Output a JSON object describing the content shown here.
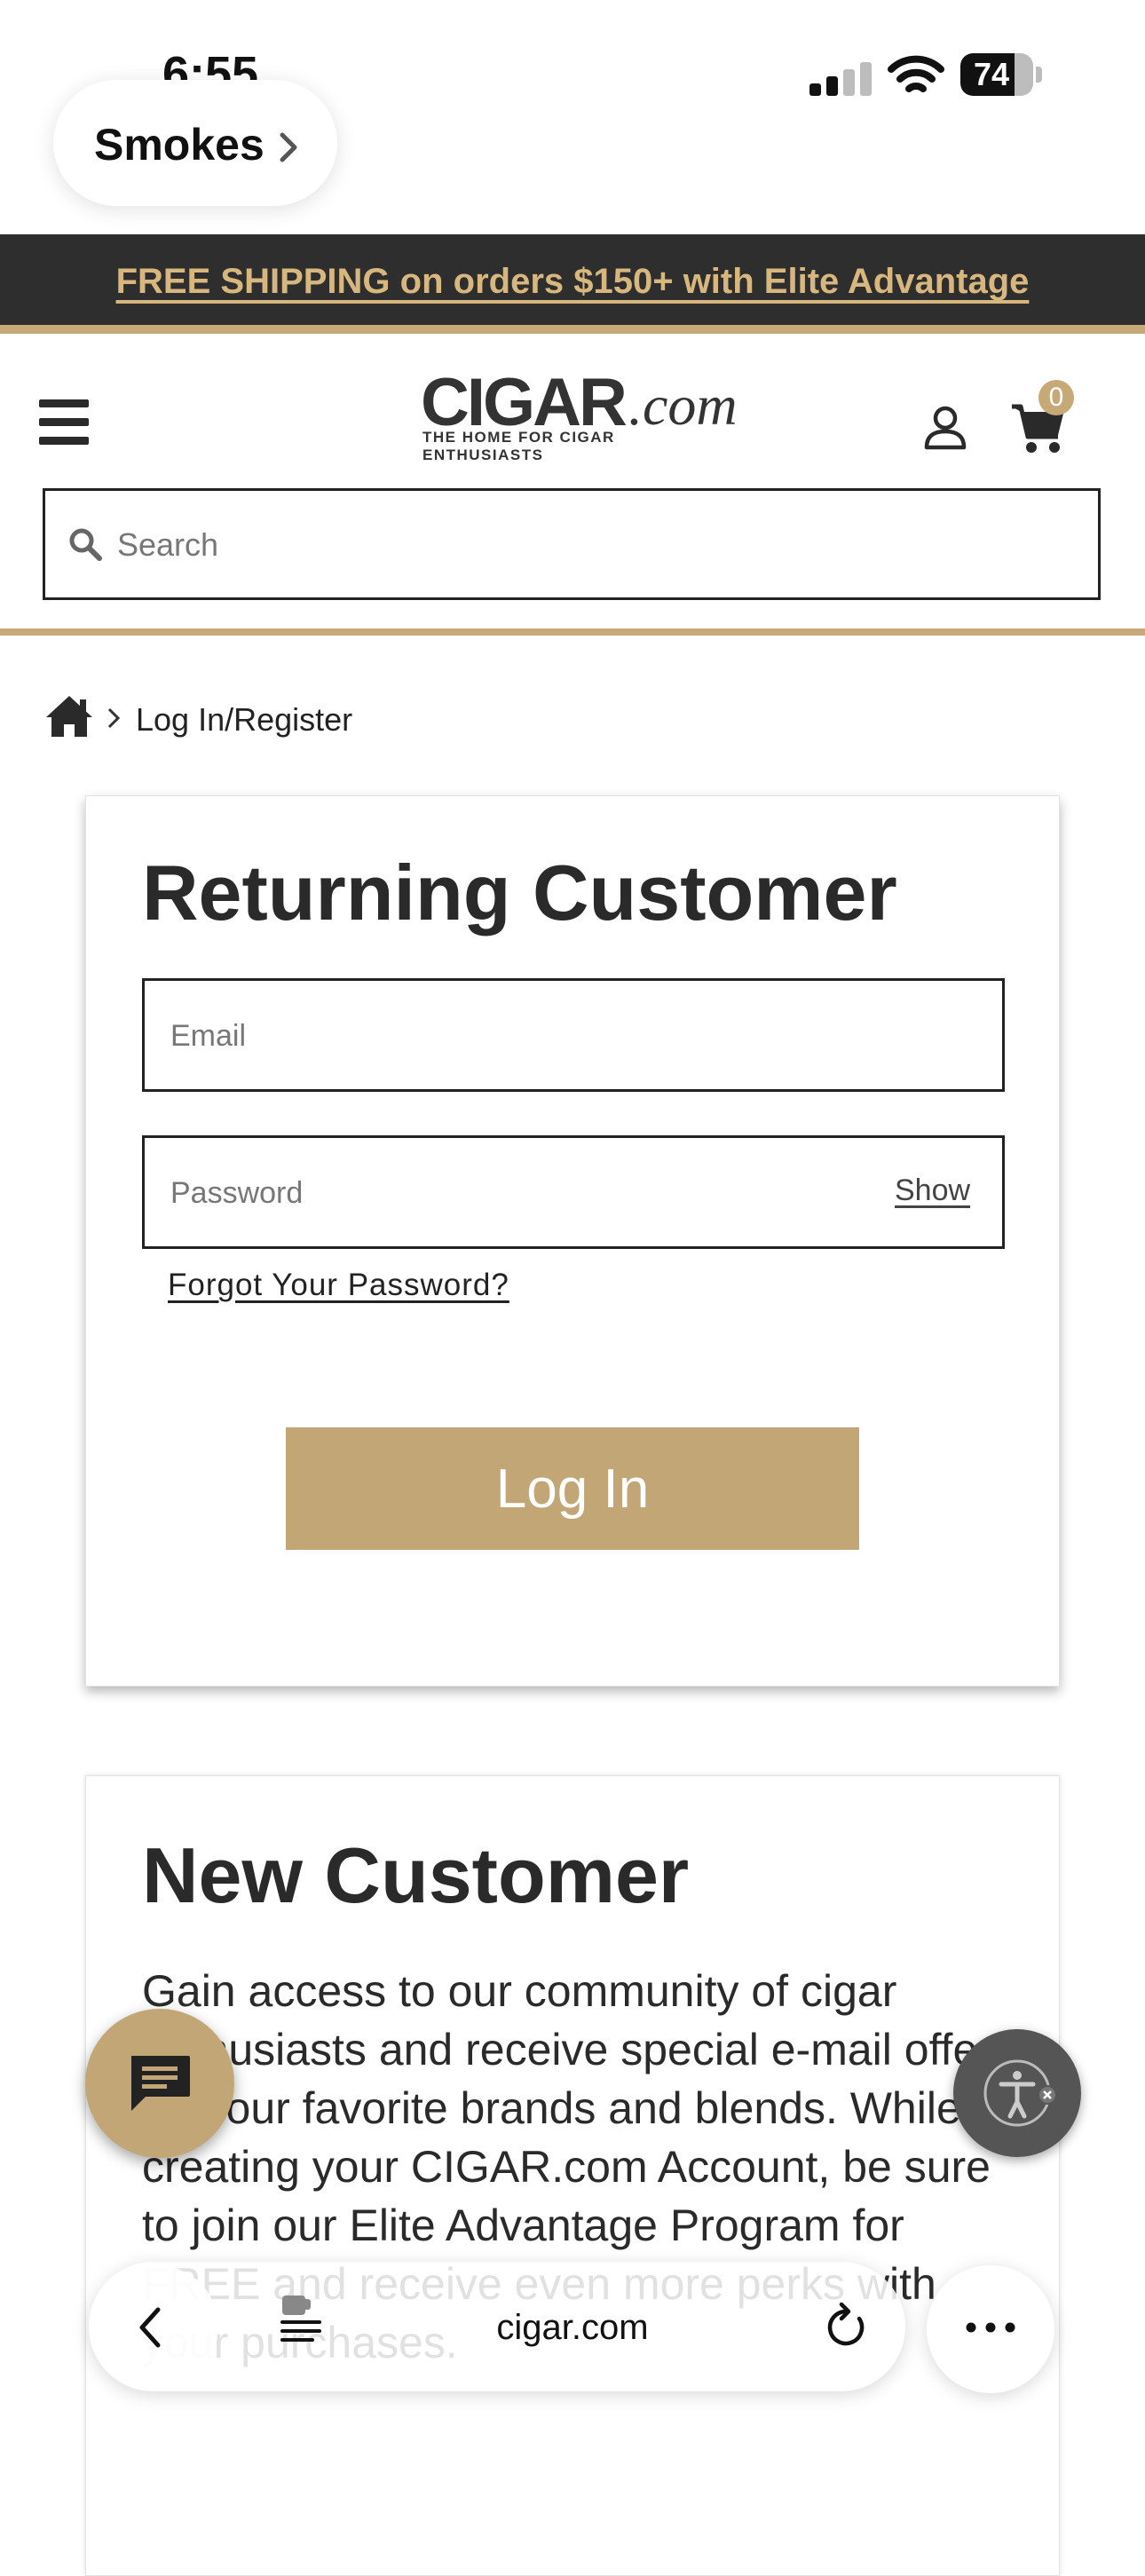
{
  "status_bar": {
    "time": "6:55",
    "battery": "74",
    "battery_level": 0.74
  },
  "back_nav": {
    "label": "Smokes"
  },
  "promo": {
    "text": "FREE SHIPPING on orders $150+ with Elite Advantage"
  },
  "header": {
    "logo_main": "CIGAR",
    "logo_suffix": ".com",
    "logo_tagline": "THE HOME FOR CIGAR ENTHUSIASTS",
    "cart_count": "0",
    "search_placeholder": "Search"
  },
  "breadcrumb": {
    "current": "Log In/Register"
  },
  "returning": {
    "title": "Returning Customer",
    "email_placeholder": "Email",
    "password_placeholder": "Password",
    "show_label": "Show",
    "forgot_label": "Forgot Your Password?",
    "login_label": "Log In"
  },
  "new_customer": {
    "title": "New Customer",
    "description": "Gain access to our community of cigar enthusiasts and receive special e-mail offers on your favorite brands and blends. While creating your CIGAR.com Account, be sure to join our Elite Advantage Program for FREE and receive even more perks with your purchases."
  },
  "browser": {
    "url": "cigar.com"
  },
  "colors": {
    "gold": "#c2a676",
    "promo_bg": "#2e2e2e",
    "promo_text": "#d8b77f"
  }
}
